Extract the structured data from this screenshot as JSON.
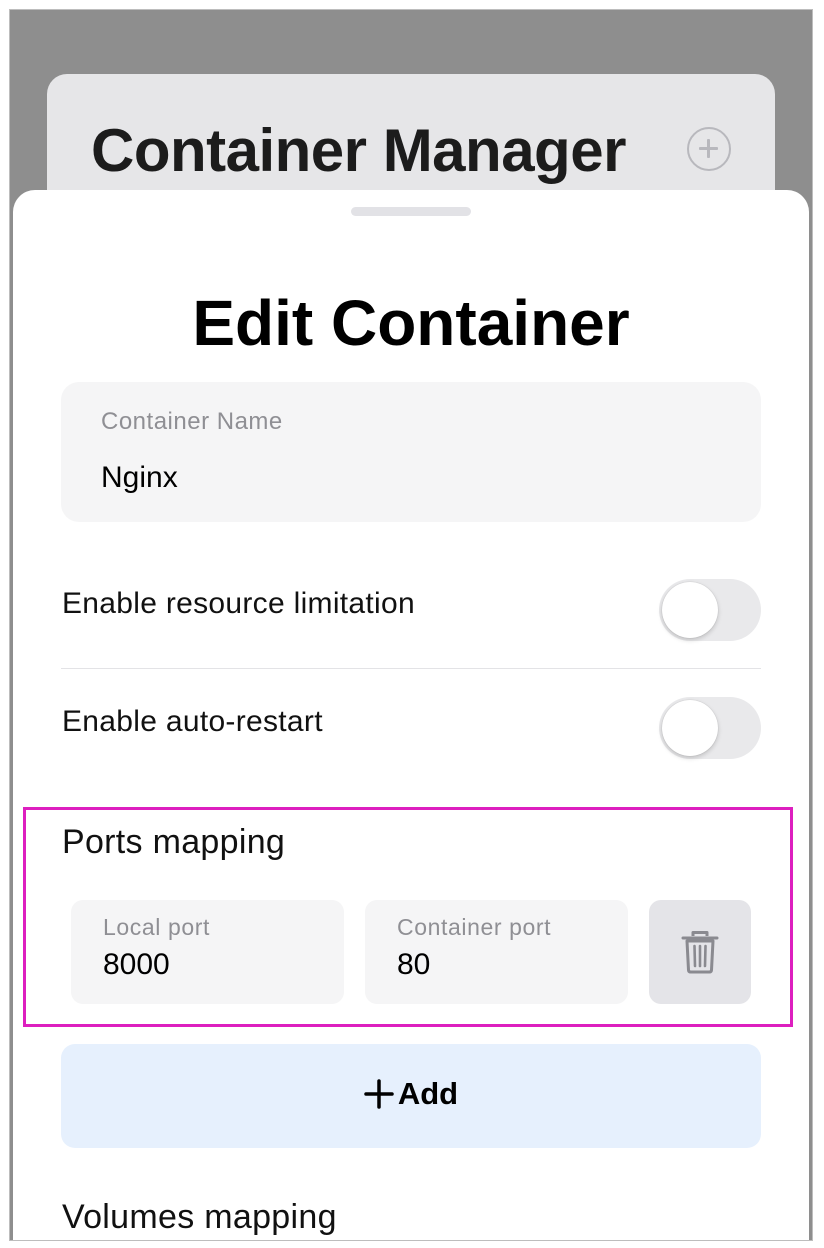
{
  "background": {
    "title": "Container Manager",
    "add_icon": "plus-circle-icon"
  },
  "sheet": {
    "title": "Edit Container",
    "container_name": {
      "label": "Container Name",
      "value": "Nginx"
    },
    "toggles": [
      {
        "label": "Enable resource limitation",
        "on": false
      },
      {
        "label": "Enable auto-restart",
        "on": false
      }
    ],
    "ports_mapping": {
      "title": "Ports mapping",
      "local_port": {
        "label": "Local port",
        "value": "8000"
      },
      "container_port": {
        "label": "Container port",
        "value": "80"
      },
      "delete_icon": "trash-icon"
    },
    "add_button": {
      "label": "Add",
      "icon": "plus-icon"
    },
    "volumes_mapping": {
      "title": "Volumes mapping"
    }
  },
  "colors": {
    "highlight_border": "#dd1fbf",
    "add_button_bg": "#e6f0fd",
    "toggle_off_bg": "#e9e9eb",
    "dim_overlay": "#8e8e8e"
  }
}
